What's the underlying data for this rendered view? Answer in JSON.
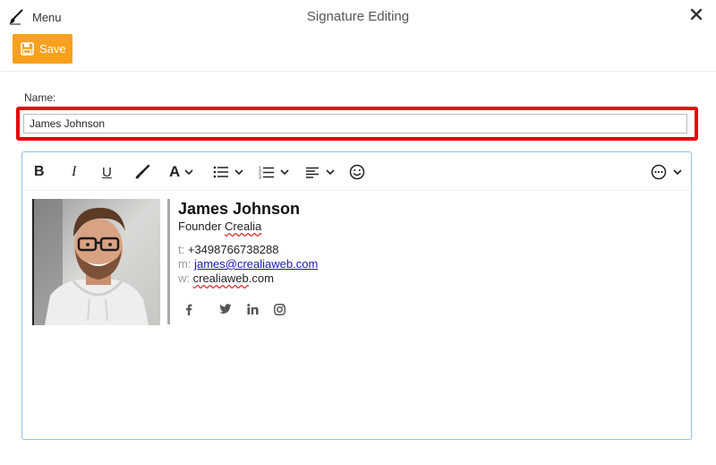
{
  "header": {
    "menu_label": "Menu",
    "title": "Signature Editing"
  },
  "toolbar": {
    "save_label": "Save"
  },
  "form": {
    "name_label": "Name:",
    "name_value": "James Johnson"
  },
  "editor_toolbar": {
    "bold": "B",
    "italic": "I",
    "underline": "U",
    "font_color": "A"
  },
  "signature": {
    "name": "James Johnson",
    "role": "Founder",
    "company": "Crealia",
    "phone_label": "t:",
    "phone": "+3498766738288",
    "email_label": "m:",
    "email": "james@crealiaweb.com",
    "web_label": "w:",
    "web_domain": "crealiaweb",
    "web_tld": ".com",
    "socials": [
      "facebook-icon",
      "twitter-icon",
      "linkedin-icon",
      "instagram-icon"
    ]
  },
  "colors": {
    "accent_orange": "#f9a01c",
    "highlight_red": "#e8000b",
    "editor_border": "#8fc3ea",
    "link_blue": "#1a1aa8"
  }
}
